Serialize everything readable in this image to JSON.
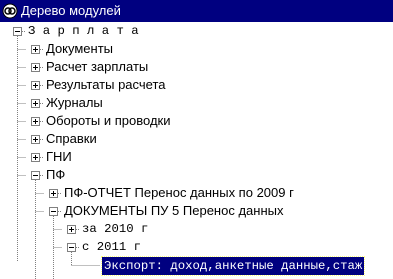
{
  "window": {
    "title": "Дерево модулей"
  },
  "icons": {
    "title_icon": "app-icon",
    "expand": "plus-box-icon",
    "collapse": "minus-box-icon"
  },
  "colors": {
    "titlebar": "#000080",
    "selection": "#000080",
    "tree_lines": "#808080"
  },
  "tree": {
    "root": {
      "label": "З а р п л а т а",
      "state": "expanded"
    },
    "items": [
      {
        "label": "Документы",
        "state": "collapsed"
      },
      {
        "label": "Расчет зарплаты",
        "state": "collapsed"
      },
      {
        "label": "Результаты расчета",
        "state": "collapsed"
      },
      {
        "label": "Журналы",
        "state": "collapsed"
      },
      {
        "label": "Обороты и проводки",
        "state": "collapsed"
      },
      {
        "label": "Справки",
        "state": "collapsed"
      },
      {
        "label": "ГНИ",
        "state": "collapsed"
      },
      {
        "label": "ПФ",
        "state": "expanded"
      }
    ],
    "pf_children": [
      {
        "label": "ПФ-ОТЧЕТ Перенос данных по 2009 г",
        "state": "collapsed"
      },
      {
        "label": "ДОКУМЕНТЫ ПУ 5 Перенос данных",
        "state": "expanded"
      }
    ],
    "pu5_children": [
      {
        "label": "за 2010 г",
        "state": "collapsed"
      },
      {
        "label": "с 2011 г",
        "state": "expanded"
      }
    ],
    "selected_item": {
      "label": "Экспорт: доход,анкетные данные,стаж"
    }
  }
}
